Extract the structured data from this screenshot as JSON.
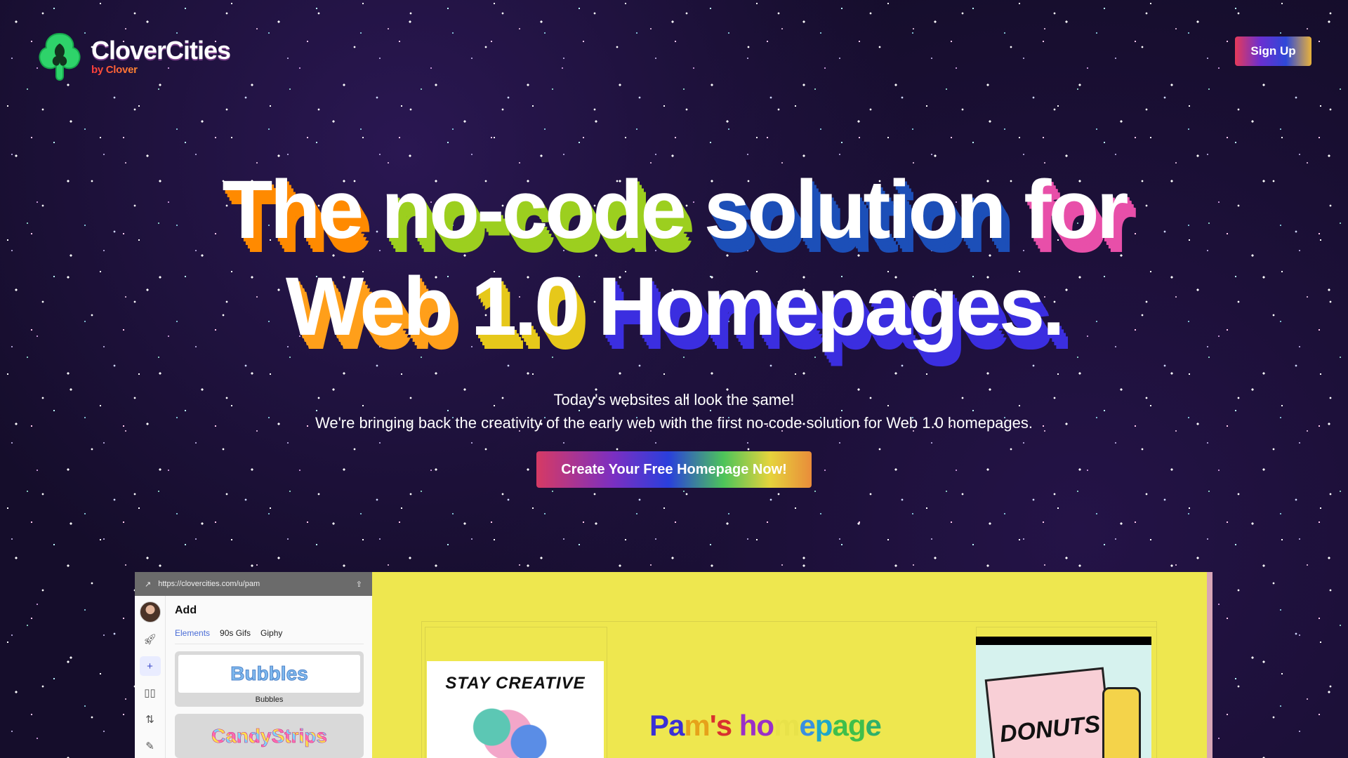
{
  "brand": {
    "name": "CloverCities",
    "byline": "by Clover"
  },
  "header": {
    "signup_label": "Sign Up"
  },
  "hero": {
    "line1": [
      "The",
      "no-code",
      "solution",
      "for"
    ],
    "line2": [
      "Web",
      "1.0",
      "Homepages."
    ],
    "subtitle_line1": "Today's websites all look the same!",
    "subtitle_line2": "We're bringing back the creativity of the early web with the first no-code solution for Web 1.0 homepages.",
    "cta_label": "Create Your Free Homepage Now!"
  },
  "editor": {
    "url": "https://clovercities.com/u/pam",
    "panel_title": "Add",
    "tabs": [
      "Elements",
      "90s Gifs",
      "Giphy"
    ],
    "active_tab": "Elements",
    "cards": [
      {
        "preview": "Bubbles",
        "label": "Bubbles"
      },
      {
        "preview": "CandyStrips"
      }
    ],
    "rail_icons": [
      "avatar",
      "rocket-icon",
      "plus-icon",
      "book-icon",
      "sliders-icon",
      "wand-icon"
    ]
  },
  "site_preview": {
    "title": "Pam's homepage",
    "sticker_text": "STAY CREATIVE",
    "donuts_text": "DONUTS",
    "background_color": "#eee74f"
  },
  "colors": {
    "hero_rainbow": [
      "#ff6a00",
      "#ff9f1a",
      "#ffd21a",
      "#8fd11a",
      "#169a3c",
      "#1c6fb0",
      "#1f2bd8",
      "#7b2fe0",
      "#e040c8",
      "#ff4d7a"
    ]
  }
}
